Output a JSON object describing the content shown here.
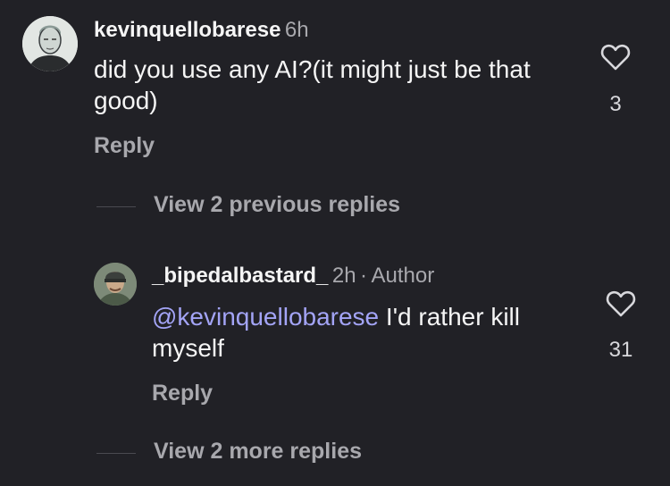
{
  "comment": {
    "username": "kevinquellobarese",
    "time": "6h",
    "text": "did you use any AI?(it might just be that good)",
    "reply_label": "Reply",
    "likes": "3"
  },
  "view_previous": "View 2 previous replies",
  "reply": {
    "username": "_bipedalbastard_",
    "time": "2h",
    "separator": "·",
    "author_tag": "Author",
    "mention": "@kevinquellobarese",
    "text": " I'd rather kill myself",
    "reply_label": "Reply",
    "likes": "31"
  },
  "view_more": "View 2 more replies",
  "colors": {
    "background": "#212126",
    "mention": "#a3a4f6",
    "secondary_text": "#a8a8ad"
  }
}
